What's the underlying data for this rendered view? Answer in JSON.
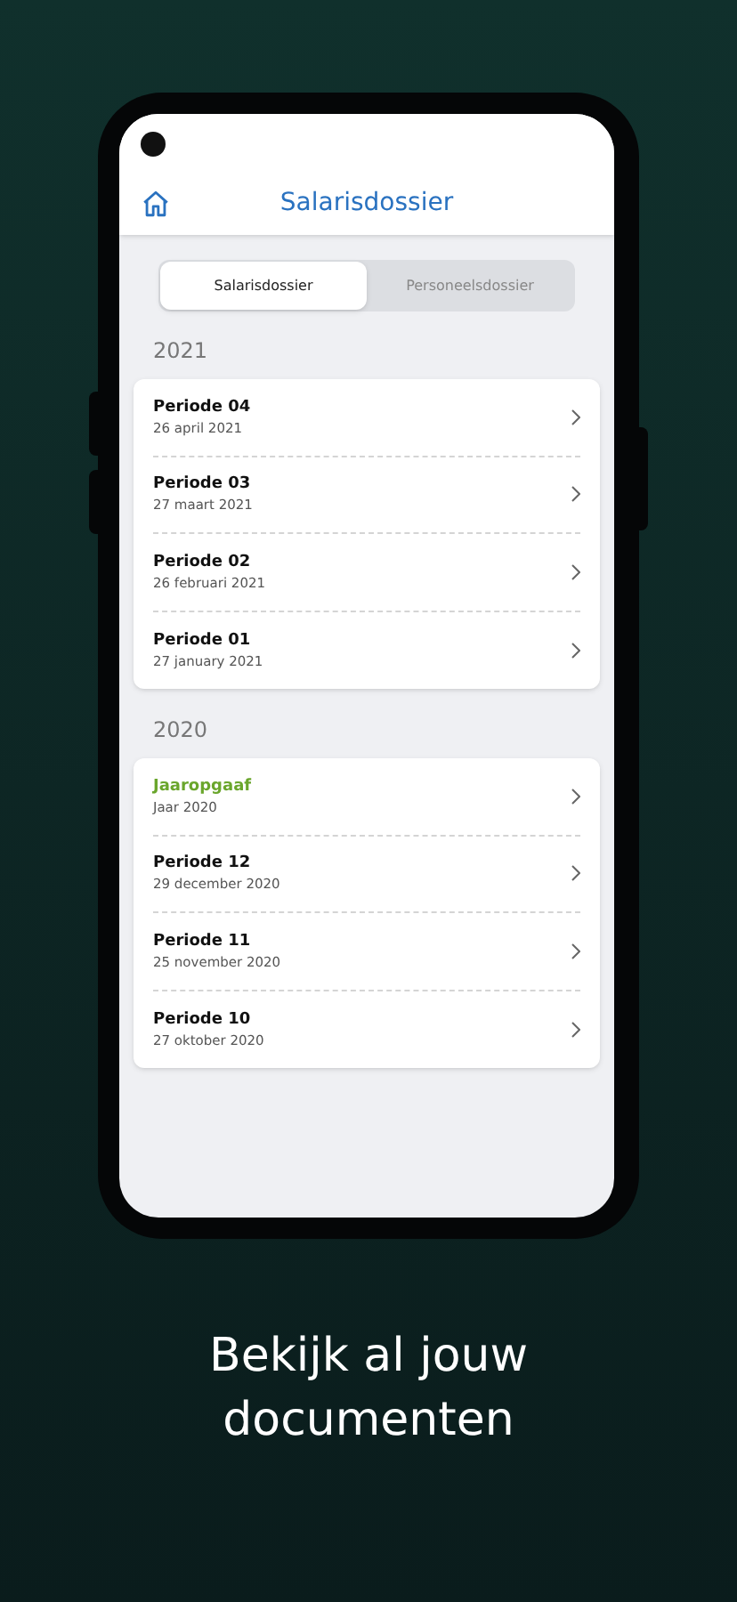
{
  "header": {
    "title": "Salarisdossier"
  },
  "tabs": [
    {
      "label": "Salarisdossier",
      "selected": true
    },
    {
      "label": "Personeelsdossier",
      "selected": false
    }
  ],
  "sections": [
    {
      "year": "2021",
      "items": [
        {
          "kind": "period",
          "title": "Periode 04",
          "date": "26 april 2021"
        },
        {
          "kind": "period",
          "title": "Periode 03",
          "date": "27 maart 2021"
        },
        {
          "kind": "period",
          "title": "Periode 02",
          "date": "26 februari 2021"
        },
        {
          "kind": "period",
          "title": "Periode 01",
          "date": "27 january 2021"
        }
      ]
    },
    {
      "year": "2020",
      "items": [
        {
          "kind": "annual",
          "title": "Jaaropgaaf",
          "date": "Jaar 2020"
        },
        {
          "kind": "period",
          "title": "Periode 12",
          "date": "29 december 2020"
        },
        {
          "kind": "period",
          "title": "Periode 11",
          "date": "25 november 2020"
        },
        {
          "kind": "period",
          "title": "Periode 10",
          "date": "27 oktober 2020"
        }
      ]
    }
  ],
  "caption": "Bekijk al jouw documenten"
}
